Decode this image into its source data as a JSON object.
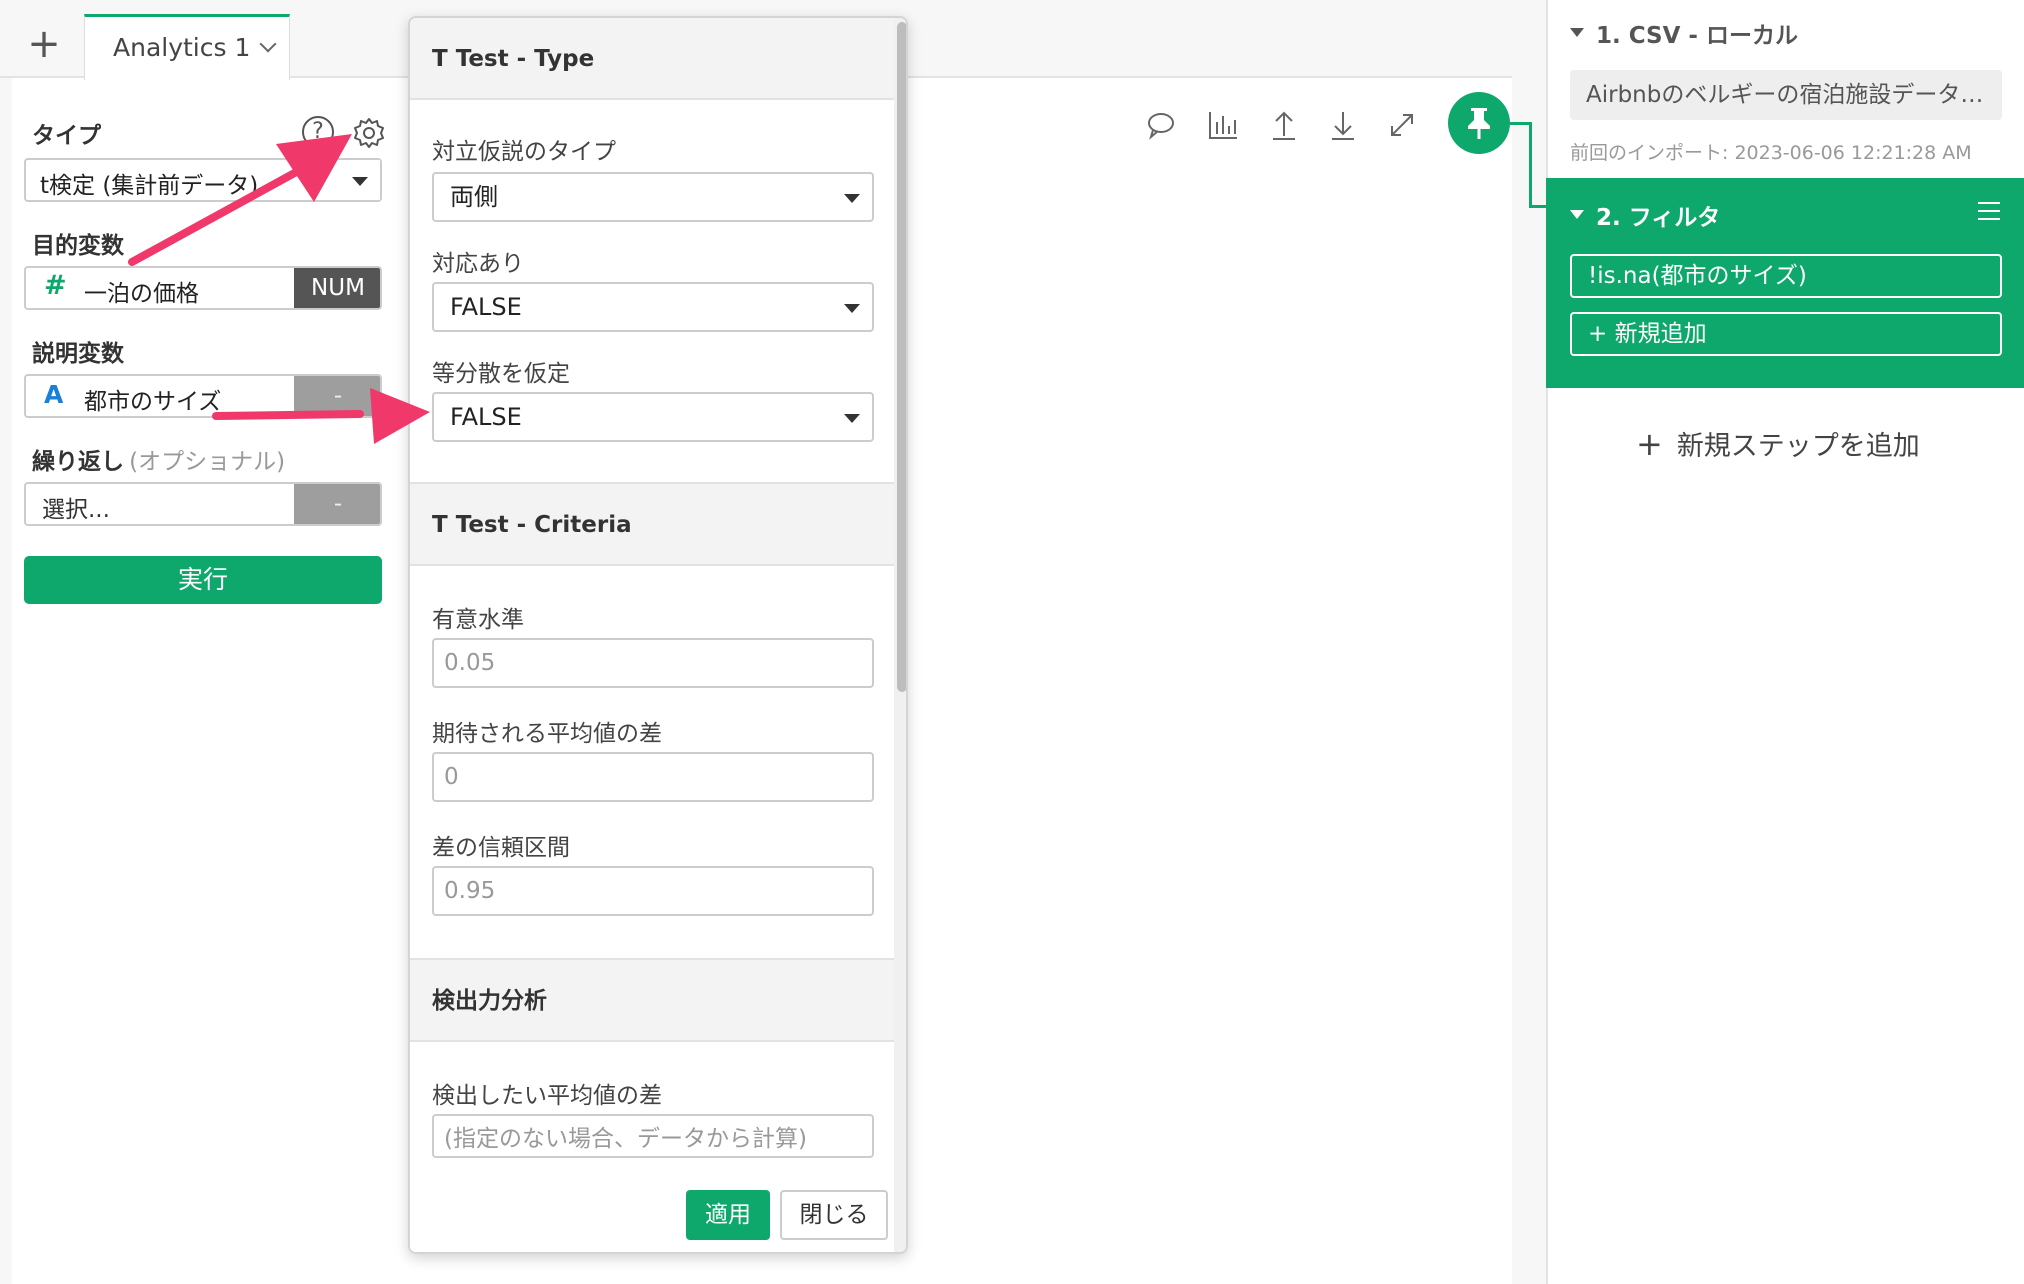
{
  "tabs": {
    "add": "+",
    "active_label": "Analytics 1"
  },
  "left_panel": {
    "type_label": "タイプ",
    "type_value": "t検定 (集計前データ)",
    "target_label": "目的変数",
    "target_icon": "#",
    "target_value": "一泊の価格",
    "target_tag": "NUM",
    "explanatory_label": "説明変数",
    "explanatory_icon": "A",
    "explanatory_value": "都市のサイズ",
    "explanatory_tag": "-",
    "repeat_label": "繰り返し",
    "repeat_optional": "(オプショナル)",
    "repeat_value": "選択...",
    "repeat_tag": "-",
    "run_button": "実行"
  },
  "popup": {
    "section1_title": "T Test - Type",
    "alt_hypothesis_label": "対立仮説のタイプ",
    "alt_hypothesis_value": "両側",
    "paired_label": "対応あり",
    "paired_value": "FALSE",
    "equal_var_label": "等分散を仮定",
    "equal_var_value": "FALSE",
    "section2_title": "T Test - Criteria",
    "sig_level_label": "有意水準",
    "sig_level_placeholder": "0.05",
    "mean_diff_label": "期待される平均値の差",
    "mean_diff_placeholder": "0",
    "conf_label": "差の信頼区間",
    "conf_placeholder": "0.95",
    "section3_title": "検出力分析",
    "detect_label": "検出したい平均値の差",
    "detect_placeholder": "(指定のない場合、データから計算)",
    "apply_button": "適用",
    "close_button": "閉じる"
  },
  "right_panel": {
    "step1_title": "1. CSV - ローカル",
    "step1_source": "Airbnbのベルギーの宿泊施設データ…",
    "step1_import": "前回のインポート: 2023-06-06 12:21:28 AM",
    "step2_title": "2. フィルタ",
    "filter_condition": "!is.na(都市のサイズ)",
    "filter_add": "+ 新規追加",
    "add_step_icon": "+",
    "add_step": "新規ステップを追加"
  },
  "colors": {
    "accent": "#0fa86c",
    "arrow": "#f0386b",
    "num_tag": "#555555"
  }
}
